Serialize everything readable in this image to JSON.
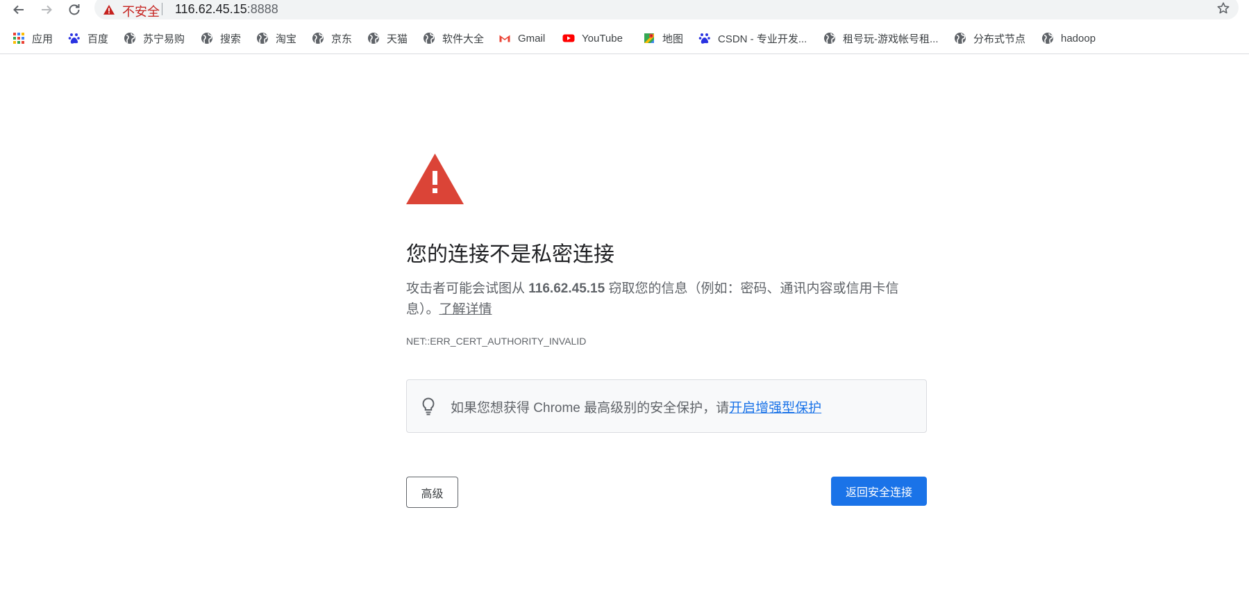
{
  "toolbar": {
    "security_label": "不安全",
    "url_host": "116.62.45.15",
    "url_port": ":8888"
  },
  "bookmarks": [
    {
      "label": "应用",
      "icon": "apps-grid-icon"
    },
    {
      "label": "百度",
      "icon": "baidu-paw-icon"
    },
    {
      "label": "苏宁易购",
      "icon": "globe-icon"
    },
    {
      "label": "搜索",
      "icon": "globe-icon"
    },
    {
      "label": "淘宝",
      "icon": "globe-icon"
    },
    {
      "label": "京东",
      "icon": "globe-icon"
    },
    {
      "label": "天猫",
      "icon": "globe-icon"
    },
    {
      "label": "软件大全",
      "icon": "globe-icon"
    },
    {
      "label": "Gmail",
      "icon": "gmail-icon"
    },
    {
      "label": "YouTube",
      "icon": "youtube-icon"
    },
    {
      "label": "地图",
      "icon": "maps-icon"
    },
    {
      "label": "CSDN - 专业开发...",
      "icon": "baidu-paw-icon"
    },
    {
      "label": "租号玩-游戏帐号租...",
      "icon": "globe-icon"
    },
    {
      "label": "分布式节点",
      "icon": "globe-icon"
    },
    {
      "label": "hadoop",
      "icon": "globe-icon"
    }
  ],
  "main": {
    "title": "您的连接不是私密连接",
    "desc_prefix": "攻击者可能会试图从 ",
    "desc_host": "116.62.45.15",
    "desc_suffix": " 窃取您的信息（例如：密码、通讯内容或信用卡信息）。",
    "learn_more": "了解详情",
    "error_code": "NET::ERR_CERT_AUTHORITY_INVALID",
    "enhanced_text": "如果您想获得 Chrome 最高级别的安全保护，请",
    "enhanced_link": "开启增强型保护",
    "advanced_button": "高级",
    "back_button": "返回安全连接"
  },
  "colors": {
    "insecure_red": "#c5221f",
    "warning_red": "#db4437",
    "primary_blue": "#1a73e8"
  }
}
